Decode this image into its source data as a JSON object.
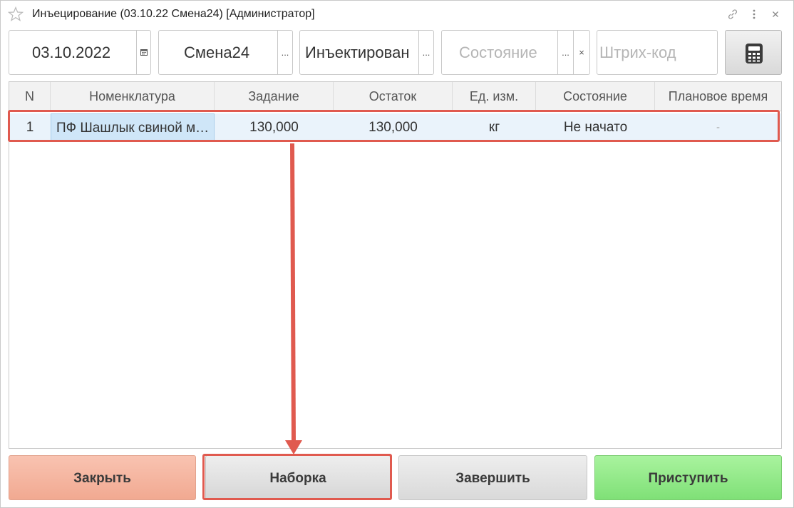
{
  "window": {
    "title": "Инъецирование (03.10.22 Смена24) [Администратор]"
  },
  "filters": {
    "date": "03.10.2022",
    "shift": "Смена24",
    "operation": "Инъектирован",
    "state_placeholder": "Состояние",
    "barcode_placeholder": "Штрих-код",
    "more_symbol": "...",
    "clear_symbol": "×"
  },
  "table": {
    "headers": [
      "N",
      "Номенклатура",
      "Задание",
      "Остаток",
      "Ед. изм.",
      "Состояние",
      "Плановое время"
    ],
    "rows": [
      [
        "1",
        "ПФ Шашлык свиной маринованный",
        "130,000",
        "130,000",
        "кг",
        "Не начато",
        "-"
      ]
    ]
  },
  "buttons": {
    "close": "Закрыть",
    "pick": "Наборка",
    "finish": "Завершить",
    "start": "Приступить"
  },
  "colors": {
    "highlight": "#e05a4f",
    "close_bg": "#f4b29b",
    "start_bg": "#8ee684",
    "selected_cell": "#cfe6f8"
  },
  "icons": {
    "favorite": "star-icon",
    "link": "link-icon",
    "menu": "more-vertical-icon",
    "close": "close-icon",
    "calendar": "calendar-icon",
    "calculator": "calculator-icon"
  }
}
